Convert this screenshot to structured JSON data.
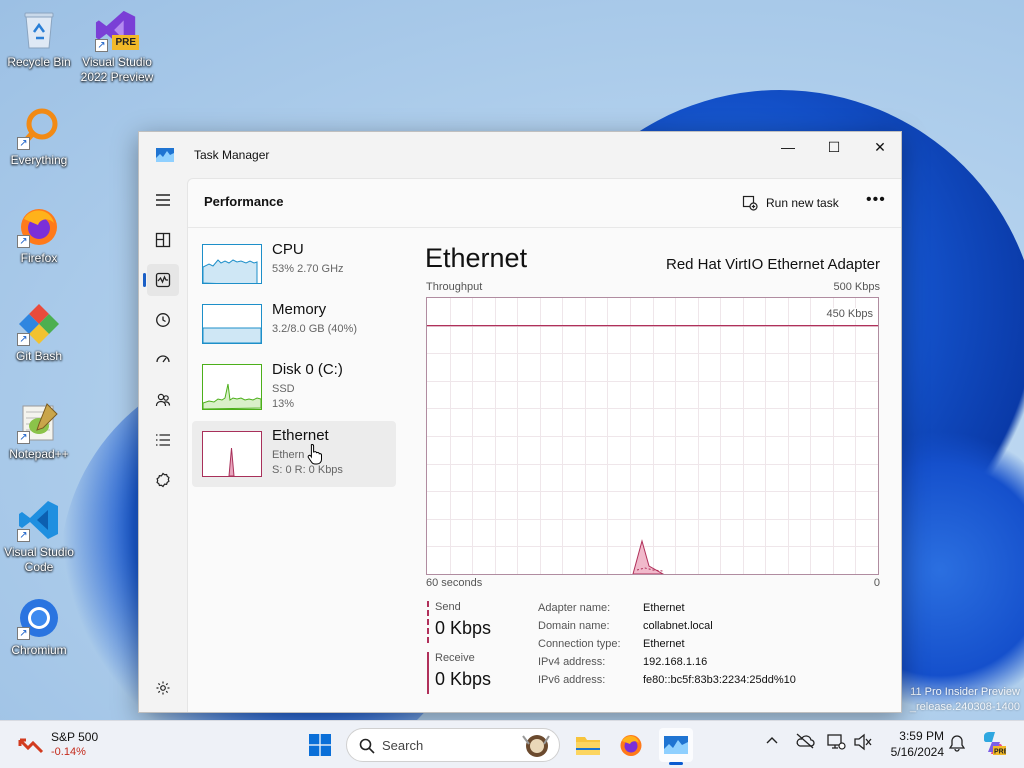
{
  "desktop": {
    "icons": [
      {
        "label": "Recycle Bin",
        "icon": "recycle-bin-icon"
      },
      {
        "label": "Visual Studio 2022 Preview",
        "icon": "visual-studio-preview-icon",
        "badge": "PRE"
      },
      {
        "label": "Everything",
        "icon": "everything-search-icon"
      },
      {
        "label": "Firefox",
        "icon": "firefox-icon"
      },
      {
        "label": "Git Bash",
        "icon": "git-bash-icon"
      },
      {
        "label": "Notepad++",
        "icon": "notepadpp-icon"
      },
      {
        "label": "Visual Studio Code",
        "icon": "vscode-icon"
      },
      {
        "label": "Chromium",
        "icon": "chromium-icon"
      }
    ],
    "watermark_line1": "11 Pro Insider Preview",
    "watermark_line2": "_release.240308-1400"
  },
  "window": {
    "title": "Task Manager",
    "minimize": "—",
    "maximize": "☐",
    "close": "✕"
  },
  "nav": {
    "items": [
      {
        "name": "hamburger-menu-icon"
      },
      {
        "name": "processes-icon"
      },
      {
        "name": "performance-icon",
        "selected": true
      },
      {
        "name": "app-history-icon"
      },
      {
        "name": "startup-apps-icon"
      },
      {
        "name": "users-icon"
      },
      {
        "name": "details-icon"
      },
      {
        "name": "services-icon"
      },
      {
        "name": "settings-icon"
      }
    ]
  },
  "header": {
    "page_title": "Performance",
    "run_new_task": "Run new task",
    "more": "•••"
  },
  "perf_list": [
    {
      "name": "CPU",
      "sub1": "53% 2.70 GHz",
      "sub2": "",
      "color": "#1d8fc9"
    },
    {
      "name": "Memory",
      "sub1": "3.2/8.0 GB (40%)",
      "sub2": "",
      "color": "#1d8fc9"
    },
    {
      "name": "Disk 0 (C:)",
      "sub1": "SSD",
      "sub2": "13%",
      "color": "#4caf1a"
    },
    {
      "name": "Ethernet",
      "sub1": "Ethern",
      "sub2": "S: 0 R: 0 Kbps",
      "color": "#a8305a",
      "selected": true
    }
  ],
  "detail": {
    "title": "Ethernet",
    "adapter": "Red Hat VirtIO Ethernet Adapter",
    "throughput_label": "Throughput",
    "max_label": "500 Kbps",
    "line_label": "450 Kbps",
    "time_label": "60 seconds",
    "zero_label": "0",
    "line_value_kbps": 450,
    "max_value_kbps": 500,
    "send_label": "Send",
    "send_value": "0 Kbps",
    "receive_label": "Receive",
    "receive_value": "0 Kbps",
    "properties": [
      {
        "key": "Adapter name:",
        "value": "Ethernet"
      },
      {
        "key": "Domain name:",
        "value": "collabnet.local"
      },
      {
        "key": "Connection type:",
        "value": "Ethernet"
      },
      {
        "key": "IPv4 address:",
        "value": "192.168.1.16"
      },
      {
        "key": "IPv6 address:",
        "value": "fe80::bc5f:83b3:2234:25dd%10"
      }
    ]
  },
  "taskbar": {
    "stock_name": "S&P 500",
    "stock_change": "-0.14%",
    "search_placeholder": "Search",
    "time": "3:59 PM",
    "date": "5/16/2024",
    "accent": "#0a5bd0"
  }
}
